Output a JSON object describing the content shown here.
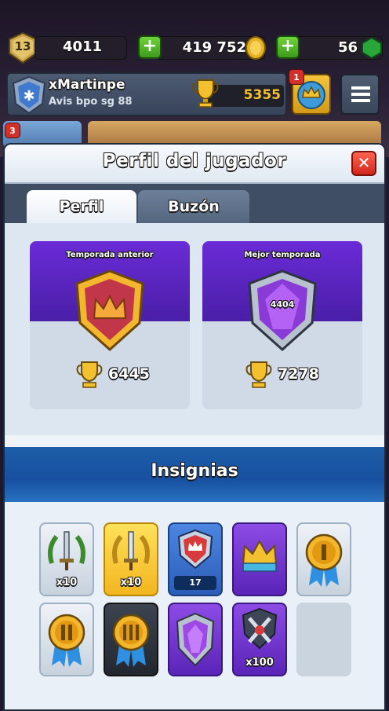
{
  "hud": {
    "level": "13",
    "experience": "4011",
    "gold": "419 752",
    "gems": "56",
    "player_name": "xMartinpe",
    "clan_name": "Avis bpo sg 88",
    "trophies": "5355",
    "notification_count": "1",
    "secondary_notification": "3"
  },
  "modal": {
    "title": "Perfil del jugador",
    "close_label": "✕",
    "tabs": [
      {
        "label": "Perfil",
        "active": true
      },
      {
        "label": "Buzón",
        "active": false
      }
    ]
  },
  "seasons": [
    {
      "label": "Temporada anterior",
      "trophies": "6445",
      "badge": "gold-crown-shield"
    },
    {
      "label": "Mejor temporada",
      "trophies": "7278",
      "badge": "purple-crystal-shield",
      "badge_value": "4404"
    }
  ],
  "badges_section": {
    "title": "Insignias",
    "items": [
      {
        "icon": "silver-sword-wreath-icon",
        "label": "x10",
        "style": "silver"
      },
      {
        "icon": "gold-sword-wreath-icon",
        "label": "x10",
        "style": "gold"
      },
      {
        "icon": "clash-royale-league-icon",
        "label": "17",
        "style": "blue"
      },
      {
        "icon": "crown-icon",
        "label": "",
        "style": "purple"
      },
      {
        "icon": "medal-i-icon",
        "label": "",
        "style": "silver"
      },
      {
        "icon": "medal-ii-icon",
        "label": "",
        "style": "silver"
      },
      {
        "icon": "medal-iii-icon",
        "label": "",
        "style": "dark"
      },
      {
        "icon": "purple-crystal-icon",
        "label": "",
        "style": "purple"
      },
      {
        "icon": "crossed-swords-icon",
        "label": "x100",
        "style": "purple"
      },
      {
        "icon": "empty-slot",
        "label": "",
        "style": "empty"
      }
    ]
  },
  "colors": {
    "modal_bg": "#eef3f8",
    "tabs_bar": "#3f4e63",
    "banner_blue": "#1d5aa6",
    "card_purple": "#5a25c0",
    "close_red": "#e0382b"
  }
}
